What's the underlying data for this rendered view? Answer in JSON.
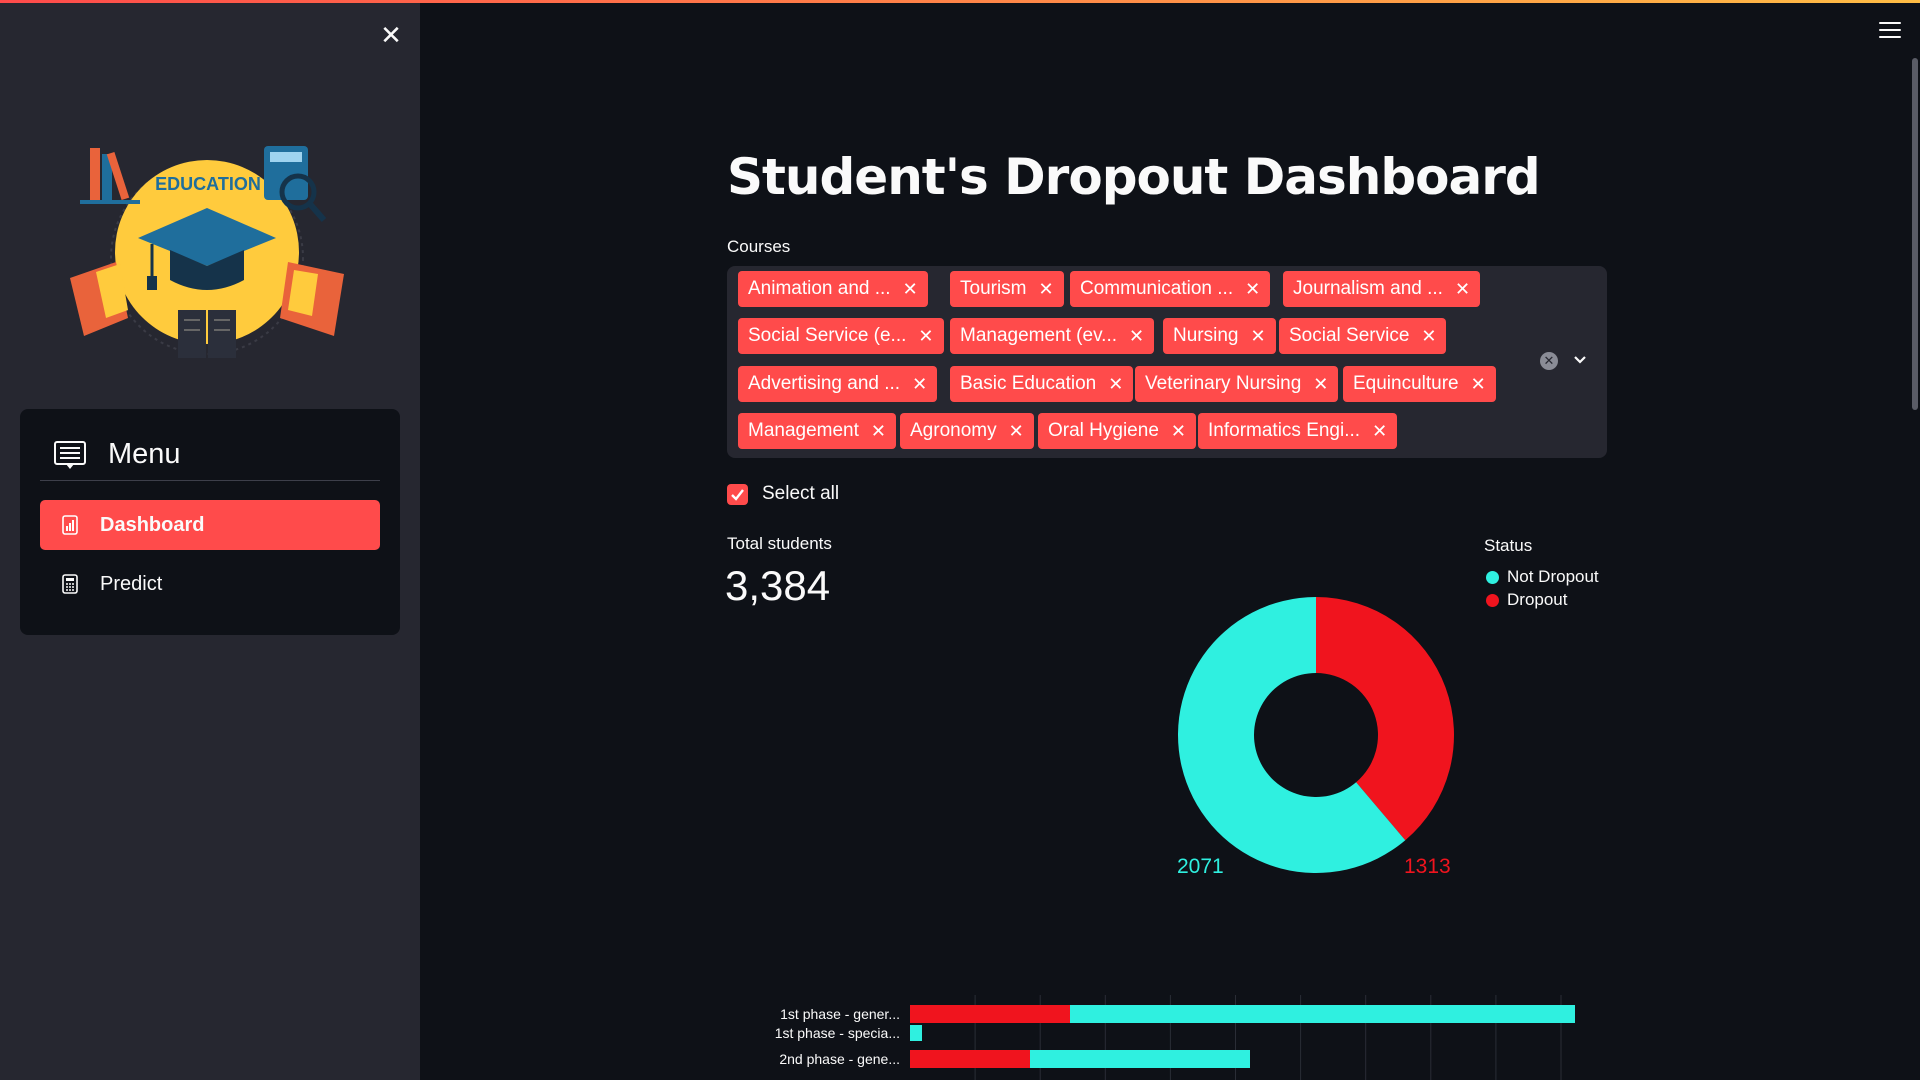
{
  "sidebar": {
    "logo_text": "EDUCATION",
    "menu_title": "Menu",
    "items": [
      {
        "label": "Dashboard",
        "active": true
      },
      {
        "label": "Predict",
        "active": false
      }
    ]
  },
  "main": {
    "title": "Student's Dropout Dashboard",
    "courses_label": "Courses",
    "courses": [
      "Animation and ...",
      "Tourism",
      "Communication ...",
      "Journalism and ...",
      "Social Service (e...",
      "Management (ev...",
      "Nursing",
      "Social Service",
      "Advertising and ...",
      "Basic Education",
      "Veterinary Nursing",
      "Equinculture",
      "Management",
      "Agronomy",
      "Oral Hygiene",
      "Informatics Engi..."
    ],
    "select_all_label": "Select all",
    "select_all_checked": true,
    "metric": {
      "label": "Total students",
      "value": "3,384"
    }
  },
  "colors": {
    "accent": "#ff4b4b",
    "not_dropout": "#2ff0e0",
    "dropout": "#f0141e"
  },
  "chart_data": [
    {
      "type": "pie",
      "legend_title": "Status",
      "legend_placement": "top-right",
      "categories": [
        "Not Dropout",
        "Dropout"
      ],
      "values": [
        2071,
        1313
      ],
      "colors": [
        "#2ff0e0",
        "#f0141e"
      ]
    },
    {
      "type": "bar",
      "orientation": "horizontal",
      "stacked": true,
      "categories": [
        "1st phase - gener...",
        "1st phase - specia...",
        "2nd phase - gene..."
      ],
      "series": [
        {
          "name": "Dropout",
          "values": [
            160,
            0,
            120
          ]
        },
        {
          "name": "Not Dropout",
          "values": [
            505,
            12,
            220
          ]
        }
      ],
      "xlim": [
        0,
        700
      ],
      "grid": true
    }
  ]
}
